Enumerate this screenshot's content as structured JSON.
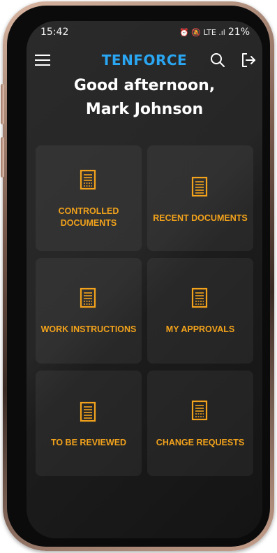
{
  "status_bar": {
    "time": "15:42",
    "icons_text": "⏰ 🔕 LTE .ıl",
    "battery": "21%"
  },
  "header": {
    "brand": "TENFORCE",
    "menu_icon": "hamburger-menu-icon",
    "search_icon": "search-icon",
    "logout_icon": "logout-icon"
  },
  "greeting": {
    "line1": "Good afternoon,",
    "line2": "Mark Johnson"
  },
  "tiles": [
    {
      "label_line1": "CONTROLLED",
      "label_line2": "DOCUMENTS",
      "icon": "document-icon"
    },
    {
      "label_line1": "RECENT DOCUMENTS",
      "label_line2": "",
      "icon": "document-icon"
    },
    {
      "label_line1": "WORK INSTRUCTIONS",
      "label_line2": "",
      "icon": "document-icon"
    },
    {
      "label_line1": "MY APPROVALS",
      "label_line2": "",
      "icon": "document-icon"
    },
    {
      "label_line1": "TO BE REVIEWED",
      "label_line2": "",
      "icon": "document-icon"
    },
    {
      "label_line1": "CHANGE REQUESTS",
      "label_line2": "",
      "icon": "document-icon"
    }
  ],
  "colors": {
    "brand": "#2aa6f2",
    "accent": "#f2a21b",
    "background": "#222222",
    "text": "#ffffff"
  }
}
